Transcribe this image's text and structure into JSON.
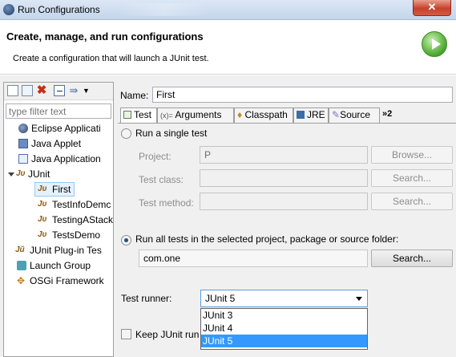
{
  "window": {
    "title": "Run Configurations",
    "close_label": "✕"
  },
  "header": {
    "title": "Create, manage, and run configurations",
    "subtitle": "Create a configuration that will launch a JUnit test."
  },
  "left": {
    "filter_placeholder": "type filter text",
    "tree": [
      {
        "label": "Eclipse Applicati",
        "icon": "eclipse-icon"
      },
      {
        "label": "Java Applet",
        "icon": "java-applet-icon"
      },
      {
        "label": "Java Application",
        "icon": "java-application-icon"
      },
      {
        "label": "JUnit",
        "icon": "junit-icon",
        "expanded": true
      },
      {
        "label": "First",
        "icon": "junit-icon",
        "selected": true
      },
      {
        "label": "TestInfoDemc",
        "icon": "junit-icon"
      },
      {
        "label": "TestingAStack",
        "icon": "junit-icon"
      },
      {
        "label": "TestsDemo",
        "icon": "junit-icon"
      },
      {
        "label": "JUnit Plug-in Tes",
        "icon": "junit-plugin-icon"
      },
      {
        "label": "Launch Group",
        "icon": "launch-group-icon"
      },
      {
        "label": "OSGi Framework",
        "icon": "osgi-icon"
      }
    ]
  },
  "form": {
    "name_label": "Name:",
    "name_value": "First",
    "tabs": [
      "Test",
      "Arguments",
      "Classpath",
      "JRE",
      "Source",
      "»2"
    ],
    "run_single_label": "Run a single test",
    "project_label": "Project:",
    "project_value": "P",
    "browse_label": "Browse...",
    "test_class_label": "Test class:",
    "test_class_value": "",
    "search_label": "Search...",
    "test_method_label": "Test method:",
    "test_method_value": "",
    "run_all_label": "Run all tests in the selected project, package or source folder:",
    "container_value": "com.one",
    "test_runner_label": "Test runner:",
    "runner_selected": "JUnit 5",
    "runner_options": [
      "JUnit 3",
      "JUnit 4",
      "JUnit 5"
    ],
    "keep_junit_label": "Keep JUnit run"
  },
  "colors": {
    "accent": "#3399ff",
    "selection": "#e5f1fb",
    "run_green": "#58b13a"
  }
}
